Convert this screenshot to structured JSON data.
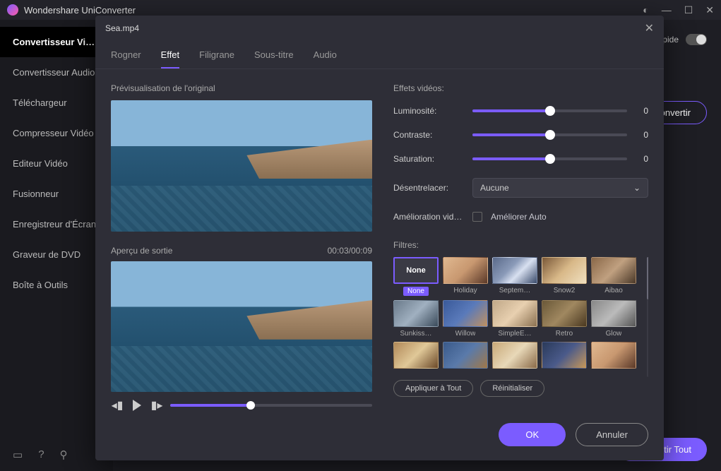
{
  "titlebar": {
    "app_name": "Wondershare UniConverter"
  },
  "sidebar": {
    "items": [
      {
        "label": "Convertisseur Vidéo"
      },
      {
        "label": "Convertisseur Audio"
      },
      {
        "label": "Téléchargeur"
      },
      {
        "label": "Compresseur Vidéo"
      },
      {
        "label": "Editeur Vidéo"
      },
      {
        "label": "Fusionneur"
      },
      {
        "label": "Enregistreur d'Écran"
      },
      {
        "label": "Graveur de DVD"
      },
      {
        "label": "Boîte à Outils"
      }
    ]
  },
  "main": {
    "fast_label": "rapide",
    "convert_btn": "Convertir",
    "convert_all": "Convertir Tout"
  },
  "modal": {
    "filename": "Sea.mp4",
    "tabs": [
      {
        "label": "Rogner"
      },
      {
        "label": "Effet"
      },
      {
        "label": "Filigrane"
      },
      {
        "label": "Sous-titre"
      },
      {
        "label": "Audio"
      }
    ],
    "original_label": "Prévisualisation de l'original",
    "output_label": "Aperçu de sortie",
    "timecode": "00:03/00:09",
    "effects_heading": "Effets vidéos:",
    "fields": {
      "brightness": {
        "label": "Luminosité:",
        "value": "0"
      },
      "contrast": {
        "label": "Contraste:",
        "value": "0"
      },
      "saturation": {
        "label": "Saturation:",
        "value": "0"
      },
      "deinterlace": {
        "label": "Désentrelacer:",
        "selected": "Aucune"
      },
      "enhance": {
        "label": "Amélioration vid…",
        "checkbox_label": "Améliorer Auto"
      }
    },
    "filters_label": "Filtres:",
    "filters": [
      {
        "name": "None",
        "thumb_text": "None"
      },
      {
        "name": "Holiday"
      },
      {
        "name": "Septem…"
      },
      {
        "name": "Snow2"
      },
      {
        "name": "Aibao"
      },
      {
        "name": "Sunkiss…"
      },
      {
        "name": "Willow"
      },
      {
        "name": "SimpleE…"
      },
      {
        "name": "Retro"
      },
      {
        "name": "Glow"
      },
      {
        "name": ""
      },
      {
        "name": ""
      },
      {
        "name": ""
      },
      {
        "name": ""
      },
      {
        "name": ""
      }
    ],
    "apply_all": "Appliquer à Tout",
    "reset": "Réinitialiser",
    "ok": "OK",
    "cancel": "Annuler"
  }
}
